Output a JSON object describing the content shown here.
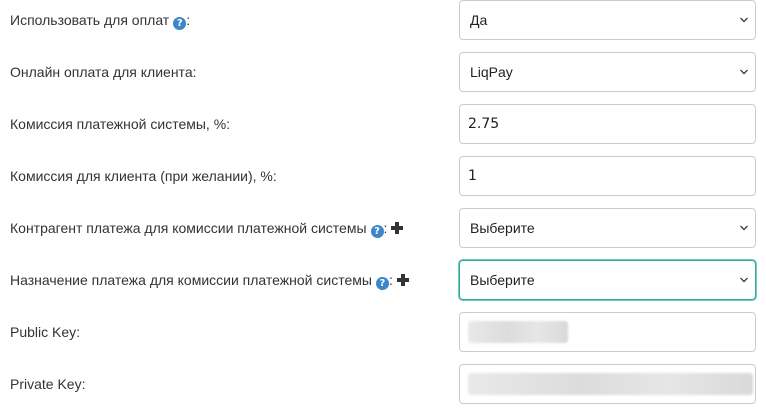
{
  "fields": {
    "use_for_payments": {
      "label": "Использовать для оплат",
      "suffix": ":",
      "value": "Да"
    },
    "online_payment": {
      "label": "Онлайн оплата для клиента:",
      "value": "LiqPay"
    },
    "system_commission": {
      "label": "Комиссия платежной системы, %:",
      "value": "2.75"
    },
    "client_commission": {
      "label": "Комиссия для клиента (при желании), %:",
      "value": "1"
    },
    "commission_counterparty": {
      "label": "Контрагент платежа для комиссии платежной системы",
      "suffix": ":",
      "value": "Выберите"
    },
    "commission_purpose": {
      "label": "Назначение платежа для комиссии платежной системы",
      "suffix": ":",
      "value": "Выберите"
    },
    "public_key": {
      "label": "Public Key:"
    },
    "private_key": {
      "label": "Private Key:"
    }
  },
  "icons": {
    "help": "question-circle-icon",
    "add": "plus-icon",
    "dropdown": "chevron-down-icon"
  },
  "colors": {
    "help_icon": "#3a87c9",
    "focus_border": "#33a99a",
    "text": "#333333",
    "border": "#cccccc"
  }
}
